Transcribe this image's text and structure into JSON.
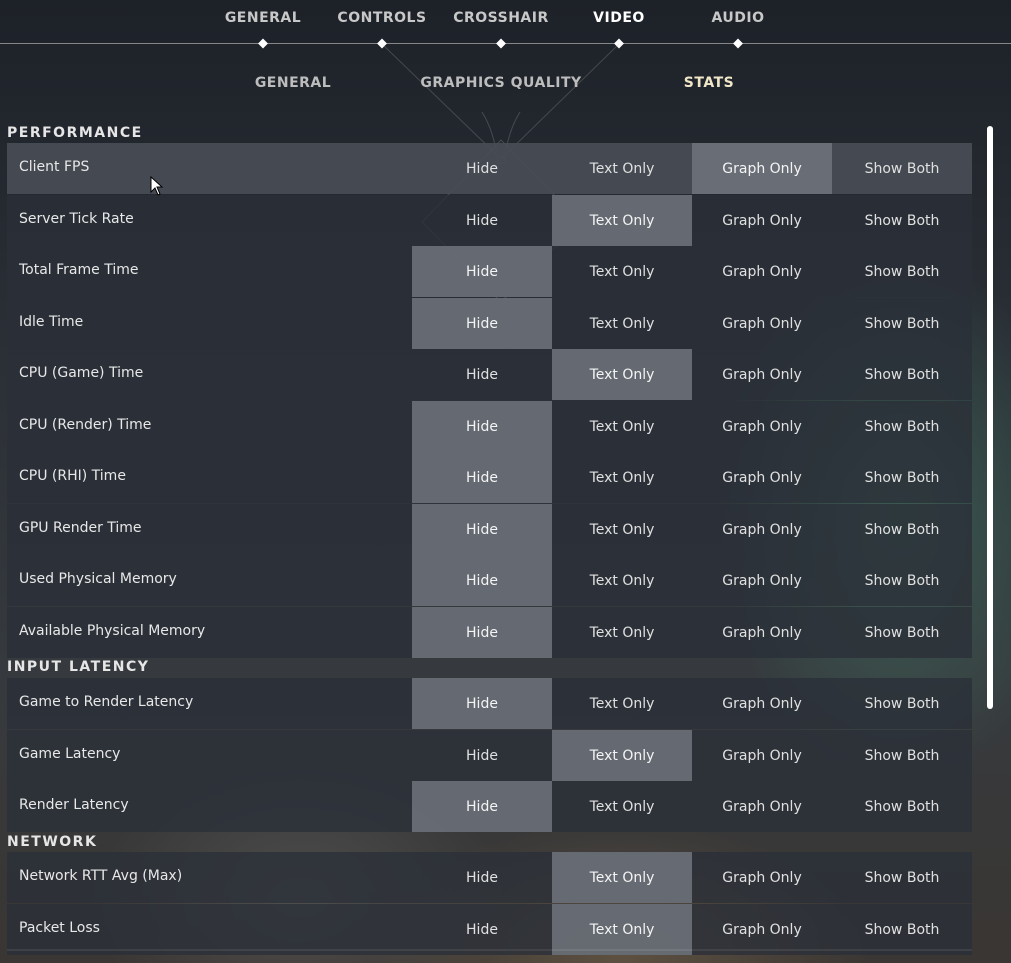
{
  "top_tabs": [
    {
      "label": "GENERAL",
      "active": false
    },
    {
      "label": "CONTROLS",
      "active": false
    },
    {
      "label": "CROSSHAIR",
      "active": false
    },
    {
      "label": "VIDEO",
      "active": true
    },
    {
      "label": "AUDIO",
      "active": false
    }
  ],
  "sub_tabs": [
    {
      "label": "GENERAL",
      "active": false
    },
    {
      "label": "GRAPHICS QUALITY",
      "active": false
    },
    {
      "label": "STATS",
      "active": true
    }
  ],
  "option_labels": [
    "Hide",
    "Text Only",
    "Graph Only",
    "Show Both"
  ],
  "sections": [
    {
      "title": "PERFORMANCE",
      "rows": [
        {
          "label": "Client FPS",
          "selected": "Graph Only"
        },
        {
          "label": "Server Tick Rate",
          "selected": "Text Only"
        },
        {
          "label": "Total Frame Time",
          "selected": "Hide"
        },
        {
          "label": "Idle Time",
          "selected": "Hide"
        },
        {
          "label": "CPU (Game) Time",
          "selected": "Text Only"
        },
        {
          "label": "CPU (Render) Time",
          "selected": "Hide"
        },
        {
          "label": "CPU (RHI) Time",
          "selected": "Hide"
        },
        {
          "label": "GPU Render Time",
          "selected": "Hide"
        },
        {
          "label": "Used Physical Memory",
          "selected": "Hide"
        },
        {
          "label": "Available Physical Memory",
          "selected": "Hide"
        }
      ]
    },
    {
      "title": "INPUT LATENCY",
      "rows": [
        {
          "label": "Game to Render Latency",
          "selected": "Hide"
        },
        {
          "label": "Game Latency",
          "selected": "Text Only"
        },
        {
          "label": "Render Latency",
          "selected": "Hide"
        }
      ]
    },
    {
      "title": "NETWORK",
      "rows": [
        {
          "label": "Network RTT Avg (Max)",
          "selected": "Text Only"
        },
        {
          "label": "Packet Loss",
          "selected": "Text Only"
        }
      ]
    }
  ],
  "colors": {
    "selected_option": "#70747c",
    "row_bg": "#2a2f38",
    "active_subtab": "#f0e6c8"
  }
}
